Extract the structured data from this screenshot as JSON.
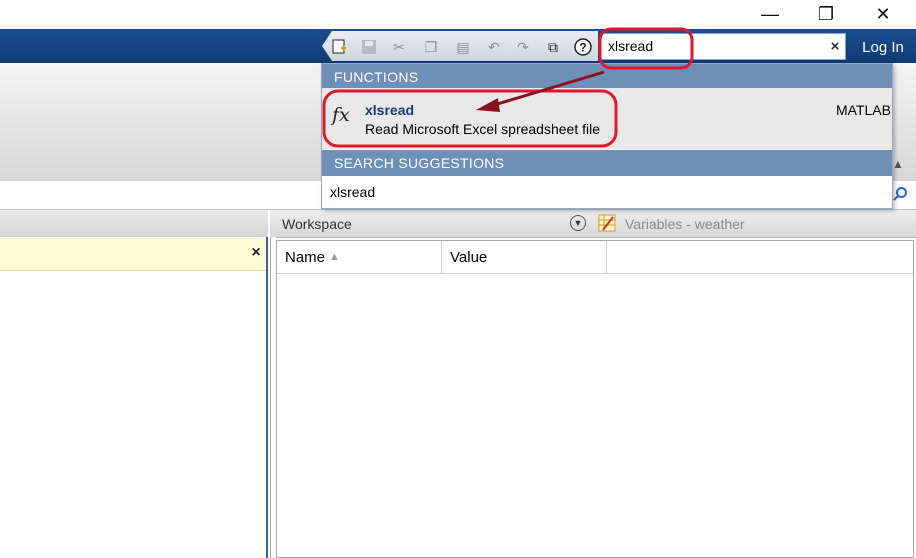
{
  "window": {
    "minimize_icon": "minimize-icon",
    "restore_icon": "restore-icon",
    "close_icon": "close-icon"
  },
  "quick_access": {
    "icons": [
      "new-script-icon",
      "save-icon",
      "cut-icon",
      "copy-icon",
      "paste-icon",
      "undo-icon",
      "redo-icon",
      "switch-windows-icon",
      "help-icon"
    ]
  },
  "search": {
    "value": "xlsread",
    "clear_label": "×"
  },
  "login": {
    "label": "Log In"
  },
  "dropdown": {
    "functions_header": "FUNCTIONS",
    "function": {
      "name": "xlsread",
      "description": "Read Microsoft Excel spreadsheet file",
      "source": "MATLAB"
    },
    "suggestions_header": "SEARCH SUGGESTIONS",
    "suggestion": "xlsread"
  },
  "left_panel": {
    "close_label": "×"
  },
  "workspace": {
    "title": "Workspace",
    "variables_tab": "Variables - weather",
    "columns": [
      "Name",
      "Value"
    ]
  },
  "colors": {
    "accent_blue": "#1c4e8f",
    "section_blue": "#6e8fb8",
    "annotation_red": "#e0182c",
    "arrow_dark_red": "#8b1020"
  }
}
